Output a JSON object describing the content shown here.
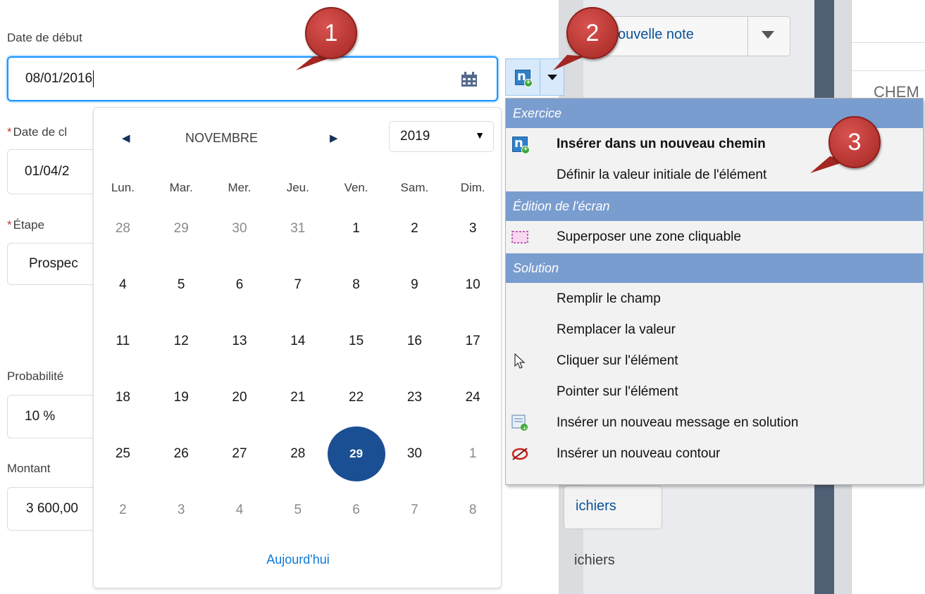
{
  "form": {
    "start_date_label": "Date de début",
    "start_date_value": "08/01/2016",
    "close_date_label": "Date de cl",
    "close_date_value": "01/04/2",
    "stage_label": "Étape",
    "stage_value": "Prospec",
    "probability_label": "Probabilité",
    "probability_value": "10 %",
    "amount_label": "Montant",
    "amount_value": "3 600,00",
    "required_mark": "*"
  },
  "calendar": {
    "prev_icon": "◀",
    "next_icon": "▶",
    "month": "NOVEMBRE",
    "year": "2019",
    "year_arrow": "▼",
    "weekdays": [
      "Lun.",
      "Mar.",
      "Mer.",
      "Jeu.",
      "Ven.",
      "Sam.",
      "Dim."
    ],
    "weeks": [
      [
        {
          "d": "28",
          "m": true
        },
        {
          "d": "29",
          "m": true
        },
        {
          "d": "30",
          "m": true
        },
        {
          "d": "31",
          "m": true
        },
        {
          "d": "1"
        },
        {
          "d": "2"
        },
        {
          "d": "3"
        }
      ],
      [
        {
          "d": "4"
        },
        {
          "d": "5"
        },
        {
          "d": "6"
        },
        {
          "d": "7"
        },
        {
          "d": "8"
        },
        {
          "d": "9"
        },
        {
          "d": "10"
        }
      ],
      [
        {
          "d": "11"
        },
        {
          "d": "12"
        },
        {
          "d": "13"
        },
        {
          "d": "14"
        },
        {
          "d": "15"
        },
        {
          "d": "16"
        },
        {
          "d": "17"
        }
      ],
      [
        {
          "d": "18"
        },
        {
          "d": "19"
        },
        {
          "d": "20"
        },
        {
          "d": "21"
        },
        {
          "d": "22"
        },
        {
          "d": "23"
        },
        {
          "d": "24"
        }
      ],
      [
        {
          "d": "25"
        },
        {
          "d": "26"
        },
        {
          "d": "27"
        },
        {
          "d": "28"
        },
        {
          "d": "29",
          "sel": true
        },
        {
          "d": "30"
        },
        {
          "d": "1",
          "m": true
        }
      ],
      [
        {
          "d": "2",
          "m": true
        },
        {
          "d": "3",
          "m": true
        },
        {
          "d": "4",
          "m": true
        },
        {
          "d": "5",
          "m": true
        },
        {
          "d": "6",
          "m": true
        },
        {
          "d": "7",
          "m": true
        },
        {
          "d": "8",
          "m": true
        }
      ]
    ],
    "today_label": "Aujourd'hui"
  },
  "background": {
    "new_note_label": "ouvelle note",
    "chem_label": "CHEM",
    "fichiers_button": "ichiers",
    "fichiers_text": "ichiers"
  },
  "menu": {
    "sections": [
      {
        "title": "Exercice",
        "items": [
          {
            "label": "Insérer dans un nouveau chemin",
            "icon": "new-path-icon",
            "bold": true
          },
          {
            "label": "Définir la valeur initiale de l'élément",
            "icon": ""
          }
        ]
      },
      {
        "title": "Édition de l'écran",
        "items": [
          {
            "label": "Superposer une zone cliquable",
            "icon": "dashed-rect-icon"
          }
        ]
      },
      {
        "title": "Solution",
        "items": [
          {
            "label": "Remplir le champ",
            "icon": ""
          },
          {
            "label": "Remplacer la valeur",
            "icon": ""
          },
          {
            "label": "Cliquer sur l'élément",
            "icon": "cursor-icon"
          },
          {
            "label": "Pointer sur l'élément",
            "icon": ""
          },
          {
            "label": "Insérer un nouveau message en solution",
            "icon": "message-icon"
          },
          {
            "label": "Insérer un nouveau contour",
            "icon": "contour-icon"
          }
        ]
      }
    ]
  },
  "callouts": [
    "1",
    "2",
    "3"
  ],
  "colors": {
    "accent": "#1b96ff",
    "selected_day": "#1b4f93",
    "menu_section": "#7a9dcf",
    "callout": "#c0392b",
    "link": "#0f78d7"
  }
}
